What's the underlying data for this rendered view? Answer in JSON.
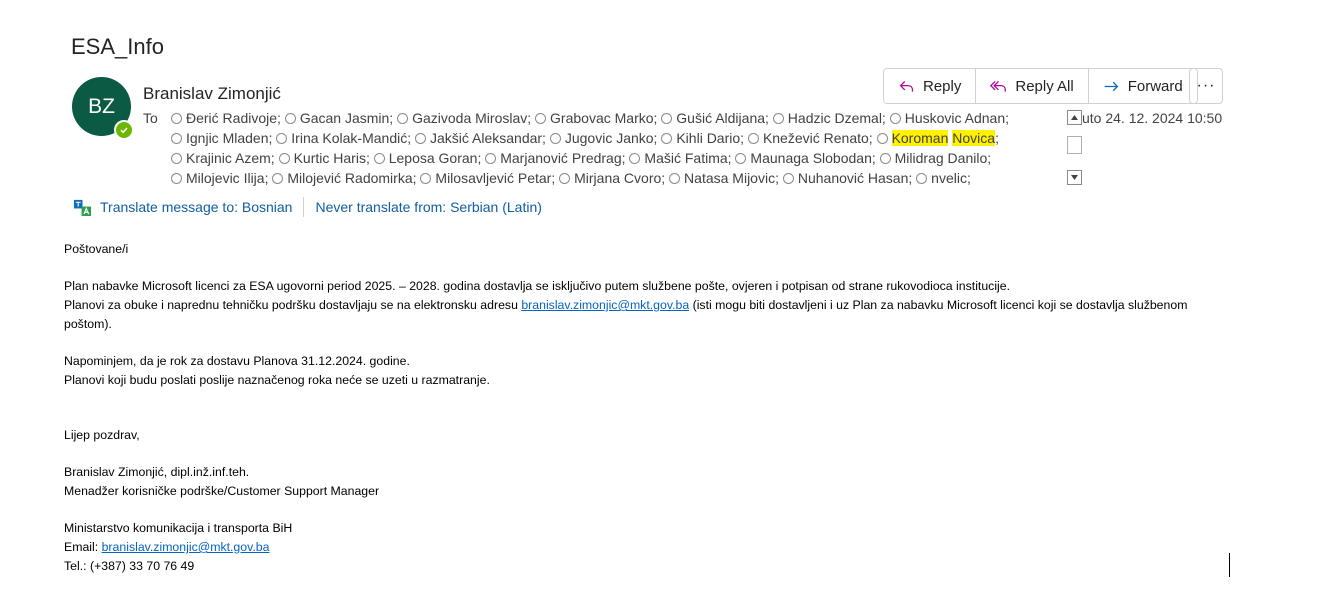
{
  "subject": "ESA_Info",
  "sender": {
    "initials": "BZ",
    "name": "Branislav Zimonjić"
  },
  "to_label": "To",
  "recipient_lines": [
    [
      "Đerić Radivoje;",
      "Gacan Jasmin;",
      "Gazivoda Miroslav;",
      "Grabovac Marko;",
      "Gušić Aldijana;",
      "Hadzic Dzemal;",
      "Huskovic Adnan;"
    ],
    [
      "Ignjic Mladen;",
      "Irina Kolak-Mandić;",
      "Jakšić Aleksandar;",
      "Jugovic Janko;",
      "Kihli Dario;",
      "Knežević Renato;"
    ],
    [
      "Krajinic Azem;",
      "Kurtic Haris;",
      "Leposa Goran;",
      "Marjanović Predrag;",
      "Mašić Fatima;",
      "Maunaga Slobodan;",
      "Milidrag Danilo;"
    ],
    [
      "Milojevic Ilija;",
      "Milojević Radomirka;",
      "Milosavljević Petar;",
      "Mirjana Cvoro;",
      "Natasa Mijovic;",
      "Nuhanović Hasan;",
      "nvelic;"
    ]
  ],
  "highlighted_recipient": {
    "first": "Koroman",
    "last": "Novica",
    "suffix": ";"
  },
  "date": "uto 24. 12. 2024 10:50",
  "actions": {
    "reply": "Reply",
    "reply_all": "Reply All",
    "forward": "Forward",
    "more": "···"
  },
  "translate": {
    "to": "Translate message to: Bosnian",
    "never": "Never translate from: Serbian (Latin)"
  },
  "body": {
    "greeting": "Poštovane/i",
    "p1": "Plan nabavke Microsoft licenci za ESA ugovorni period 2025. – 2028. godina dostavlja se isključivo putem službene pošte, ovjeren i potpisan od strane rukovodioca institucije.",
    "p2_pre": "Planovi za obuke i naprednu tehničku podršku dostavljaju se na elektronsku adresu ",
    "p2_link": "branislav.zimonjic@mkt.gov.ba",
    "p2_post": " (isti mogu biti dostavljeni i uz Plan za nabavku Microsoft licenci koji se dostavlja službenom poštom).",
    "p3": "Napominjem, da je rok za dostavu Planova 31.12.2024. godine.",
    "p4": "Planovi koji budu poslati poslije naznačenog roka neće se uzeti u razmatranje.",
    "closing": "Lijep pozdrav,",
    "sig_name": "Branislav Zimonjić, dipl.inž.inf.teh.",
    "sig_title": "Menadžer korisničke podrške/Customer Support Manager",
    "sig_org": "Ministarstvo komunikacija i transporta BiH",
    "sig_email_label": "Email: ",
    "sig_email": "branislav.zimonjic@mkt.gov.ba",
    "sig_tel": "Tel.: (+387) 33 70 76 49"
  },
  "colors": {
    "avatar": "#0b5a44",
    "presence": "#6bb700",
    "link": "#115ea3",
    "highlight": "#fff100"
  }
}
